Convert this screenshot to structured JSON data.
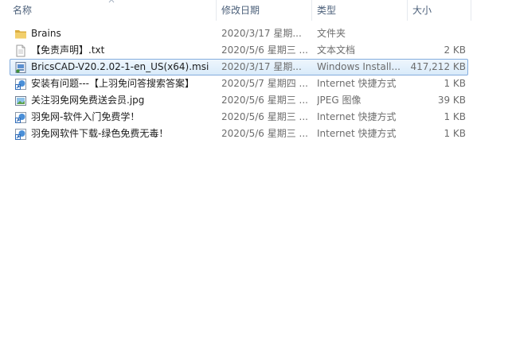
{
  "columns": {
    "name": "名称",
    "date": "修改日期",
    "type": "类型",
    "size": "大小"
  },
  "files": [
    {
      "name": "Brains",
      "date": "2020/3/17 星期...",
      "type": "文件夹",
      "size": "",
      "icon": "folder-icon"
    },
    {
      "name": "【免责声明】.txt",
      "date": "2020/5/6 星期三 ...",
      "type": "文本文档",
      "size": "2 KB",
      "icon": "text-file-icon"
    },
    {
      "name": "BricsCAD-V20.2.02-1-en_US(x64).msi",
      "date": "2020/3/17 星期...",
      "type": "Windows Install...",
      "size": "417,212 KB",
      "icon": "installer-icon",
      "selected": true
    },
    {
      "name": "安装有问题---【上羽免问答搜索答案】",
      "date": "2020/5/7 星期四 ...",
      "type": "Internet 快捷方式",
      "size": "1 KB",
      "icon": "internet-shortcut-icon"
    },
    {
      "name": "关注羽免网免费送会员.jpg",
      "date": "2020/5/6 星期三 ...",
      "type": "JPEG 图像",
      "size": "39 KB",
      "icon": "image-file-icon"
    },
    {
      "name": "羽免网-软件入门免费学！",
      "date": "2020/5/6 星期三 ...",
      "type": "Internet 快捷方式",
      "size": "1 KB",
      "icon": "internet-shortcut-icon"
    },
    {
      "name": "羽免网软件下载-绿色免费无毒！",
      "date": "2020/5/6 星期三 ...",
      "type": "Internet 快捷方式",
      "size": "1 KB",
      "icon": "internet-shortcut-icon"
    }
  ],
  "colors": {
    "selection_border": "#84acdd",
    "header_text": "#4c607a",
    "folder": "#e8c25a"
  }
}
